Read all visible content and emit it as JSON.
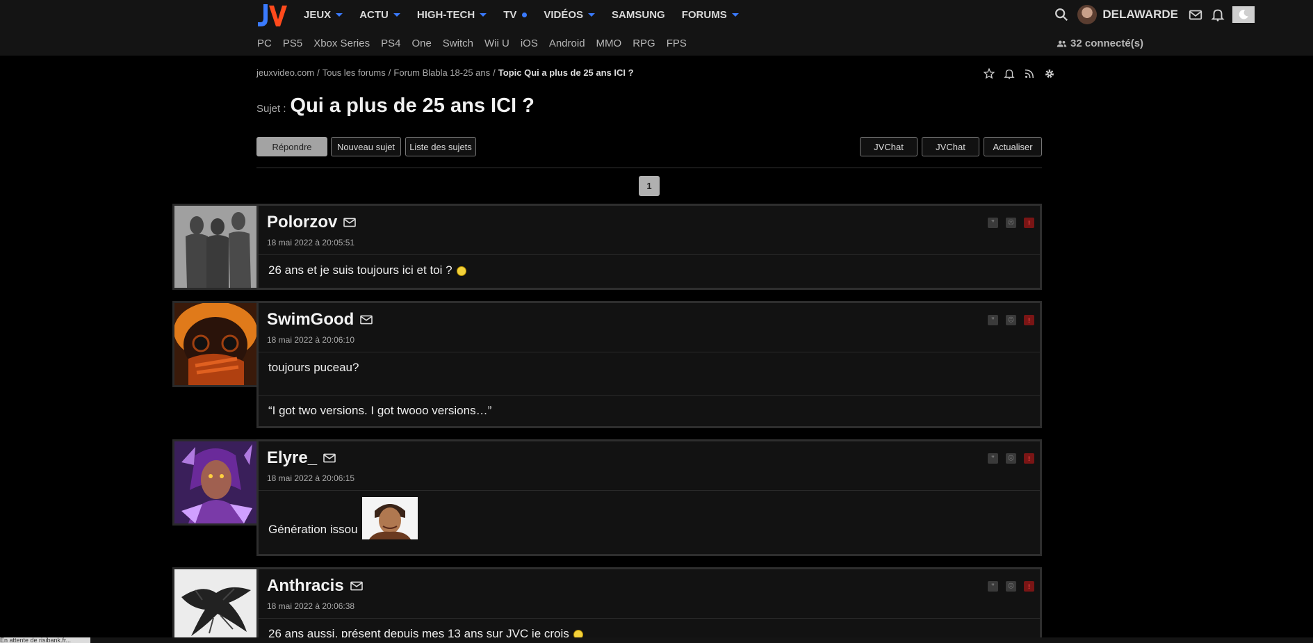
{
  "header": {
    "logo_text": "JV",
    "main_nav": [
      {
        "label": "JEUX",
        "dropdown": true
      },
      {
        "label": "ACTU",
        "dropdown": true
      },
      {
        "label": "HIGH-TECH",
        "dropdown": true
      },
      {
        "label": "TV",
        "dot": true
      },
      {
        "label": "VIDÉOS",
        "dropdown": true
      },
      {
        "label": "SAMSUNG",
        "dropdown": false
      },
      {
        "label": "FORUMS",
        "dropdown": true
      }
    ],
    "sub_nav": [
      "PC",
      "PS5",
      "Xbox Series",
      "PS4",
      "One",
      "Switch",
      "Wii U",
      "iOS",
      "Android",
      "MMO",
      "RPG",
      "FPS"
    ],
    "username": "DELAWARDE",
    "connected": "32 connecté(s)",
    "accent_color": "#3a7bff"
  },
  "breadcrumb": {
    "items": [
      "jeuxvideo.com",
      "/",
      "Tous les forums",
      "/",
      "Forum Blabla 18-25 ans",
      "/"
    ],
    "current": "Topic Qui a plus de 25 ans ICI ?"
  },
  "topic": {
    "label": "Sujet :",
    "title": "Qui a plus de 25 ans ICI ?"
  },
  "actions": {
    "reply": "Répondre",
    "new_topic": "Nouveau sujet",
    "topic_list": "Liste des sujets",
    "jvchat_1": "JVChat",
    "jvchat_2": "JVChat",
    "refresh": "Actualiser"
  },
  "pagination": {
    "current_page": "1"
  },
  "posts": [
    {
      "author": "Polorzov",
      "date": "18 mai 2022 à 20:05:51",
      "content": "26 ans et je suis toujours ici et toi ?",
      "smiley": true,
      "signature": ""
    },
    {
      "author": "SwimGood",
      "date": "18 mai 2022 à 20:06:10",
      "content": "toujours puceau?",
      "smiley": false,
      "signature": "“I got two versions. I got twooo versions…”"
    },
    {
      "author": "Elyre_",
      "date": "18 mai 2022 à 20:06:15",
      "content": "Génération issou",
      "smiley": false,
      "signature": ""
    },
    {
      "author": "Anthracis",
      "date": "18 mai 2022 à 20:06:38",
      "content": "26 ans aussi, présent depuis mes 13 ans sur JVC je crois",
      "smiley": true,
      "signature": ""
    }
  ],
  "status_bar": "En attente de risibank.fr..."
}
